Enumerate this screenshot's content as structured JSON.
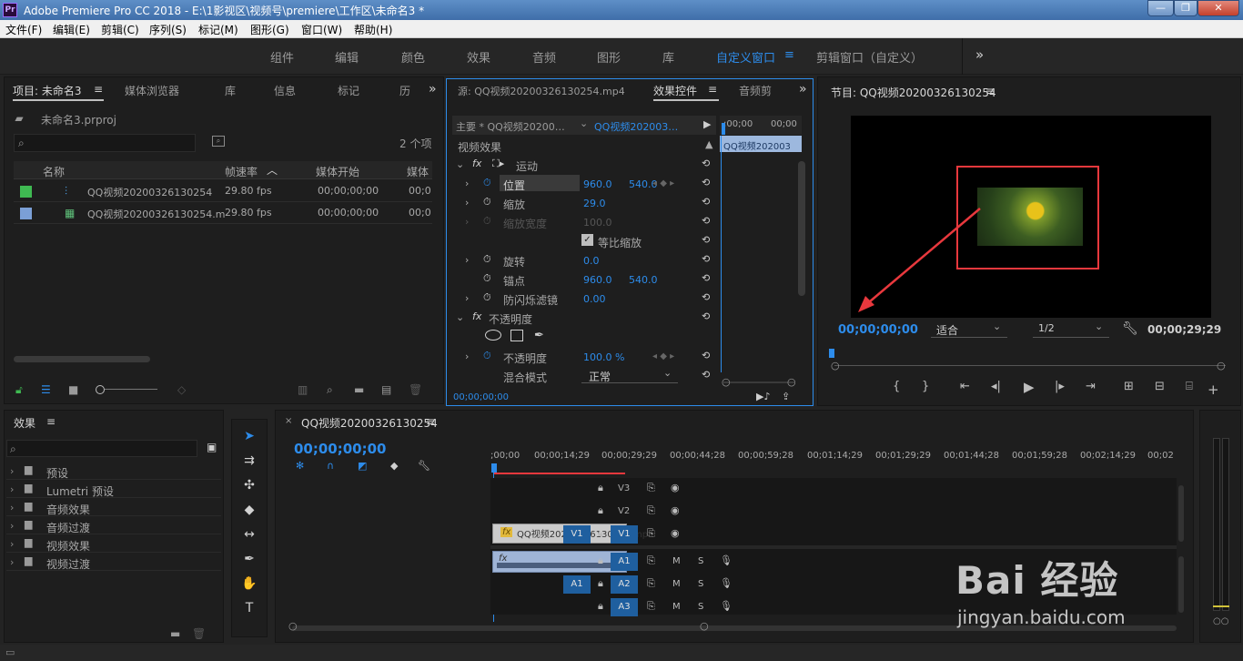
{
  "app": {
    "title": "Adobe Premiere Pro CC 2018 - E:\\1影视区\\视频号\\premiere\\工作区\\未命名3 *",
    "logo": "Pr"
  },
  "window_buttons": {
    "minimize": "—",
    "maximize": "❐",
    "close": "✕"
  },
  "menu": [
    "文件(F)",
    "编辑(E)",
    "剪辑(C)",
    "序列(S)",
    "标记(M)",
    "图形(G)",
    "窗口(W)",
    "帮助(H)"
  ],
  "workspaces": {
    "items": [
      "组件",
      "编辑",
      "颜色",
      "效果",
      "音频",
      "图形",
      "库",
      "自定义窗口",
      "剪辑窗口（自定义）"
    ],
    "active": "自定义窗口",
    "more": "»"
  },
  "project": {
    "tabs": [
      "项目: 未命名3",
      "媒体浏览器",
      "库",
      "信息",
      "标记",
      "历"
    ],
    "file": "未命名3.prproj",
    "item_count": "2 个项",
    "columns": [
      "名称",
      "帧速率",
      "媒体开始",
      "媒体"
    ],
    "rows": [
      {
        "name": "QQ视频20200326130254",
        "fps": "29.80 fps",
        "start": "00;00;00;00",
        "media": "00;0",
        "color": "#3fba52"
      },
      {
        "name": "QQ视频20200326130254.m",
        "fps": "29.80 fps",
        "start": "00;00;00;00",
        "media": "00;0",
        "color": "#7b9fd6"
      }
    ]
  },
  "effect_controls": {
    "tabs": [
      "源: QQ视频20200326130254.mp4",
      "效果控件",
      "音频剪"
    ],
    "master": "主要 * QQ视频20200…",
    "clip": "QQ视频202003…",
    "ruler": [
      ";00;00",
      "00;00"
    ],
    "mini_clip": "QQ视频202003",
    "section": "视频效果",
    "motion": "运动",
    "props": [
      {
        "name": "位置",
        "v1": "960.0",
        "v2": "540.0"
      },
      {
        "name": "缩放",
        "v1": "29.0",
        "v2": ""
      },
      {
        "name": "缩放宽度",
        "v1": "100.0",
        "v2": ""
      },
      {
        "name": "等比缩放",
        "v1": "",
        "v2": ""
      },
      {
        "name": "旋转",
        "v1": "0.0",
        "v2": ""
      },
      {
        "name": "锚点",
        "v1": "960.0",
        "v2": "540.0"
      },
      {
        "name": "防闪烁滤镜",
        "v1": "0.00",
        "v2": ""
      }
    ],
    "opacity_section": "不透明度",
    "opacity": {
      "name": "不透明度",
      "value": "100.0 %"
    },
    "blend": {
      "name": "混合模式",
      "value": "正常"
    },
    "timecode": "00;00;00;00"
  },
  "program": {
    "title": "节目: QQ视频20200326130254",
    "timecode": "00;00;00;00",
    "fit": "适合",
    "resolution": "1/2",
    "duration": "00;00;29;29"
  },
  "effects": {
    "title": "效果",
    "items": [
      "预设",
      "Lumetri 预设",
      "音频效果",
      "音频过渡",
      "视频效果",
      "视频过渡"
    ]
  },
  "timeline": {
    "title": "QQ视频20200326130254",
    "timecode": "00;00;00;00",
    "ruler": [
      ";00;00",
      "00;00;14;29",
      "00;00;29;29",
      "00;00;44;28",
      "00;00;59;28",
      "00;01;14;29",
      "00;01;29;29",
      "00;01;44;28",
      "00;01;59;28",
      "00;02;14;29",
      "00;02"
    ],
    "video_tracks": [
      "V3",
      "V2",
      "V1"
    ],
    "audio_tracks": [
      "A1",
      "A2",
      "A3"
    ],
    "source_v": "V1",
    "source_a": "A1",
    "clip_name": "QQ视频20200326130254.mp4"
  },
  "watermark": {
    "brand": "Bai 经验",
    "url": "jingyan.baidu.com"
  },
  "colors": {
    "accent": "#2d8ceb",
    "highlight": "#e8383d",
    "track_btn": "#1f5f9f"
  }
}
